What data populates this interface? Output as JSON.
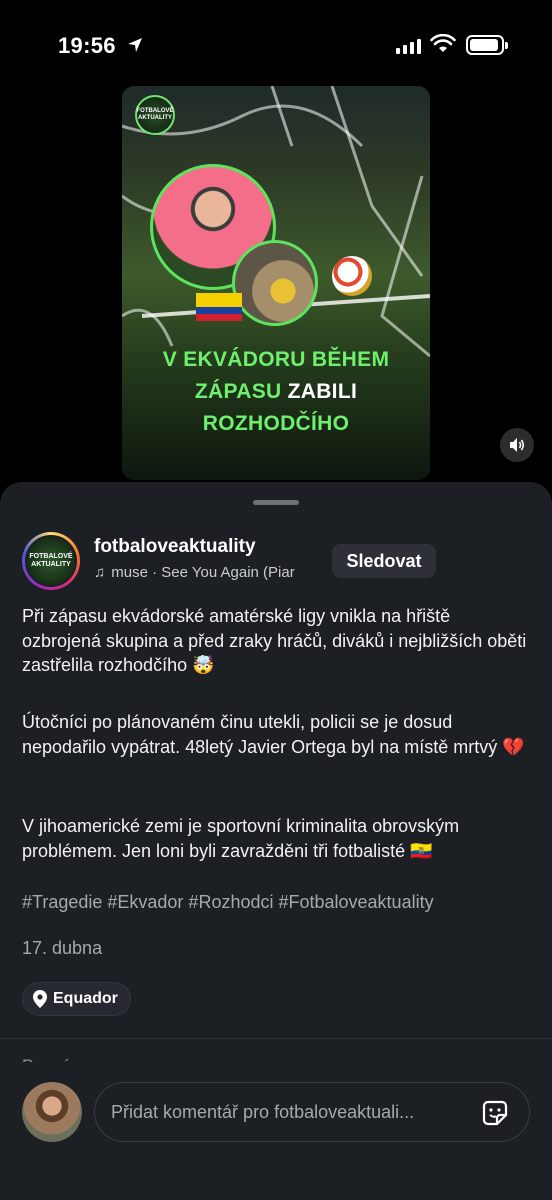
{
  "status_bar": {
    "time": "19:56"
  },
  "post_image": {
    "logo_text": "FOTBALOVÉ AKTUALITY",
    "headline_line1": "V EKVÁDORU BĚHEM",
    "headline_line2_a": "ZÁPASU",
    "headline_line2_b": "ZABILI",
    "headline_line3": "ROZHODČÍHO",
    "flag_colors": [
      "#f5d000",
      "#1d3f9e",
      "#d3202f"
    ]
  },
  "author": {
    "avatar_text": "FOTBALOVÉ AKTUALITY",
    "username": "fotbaloveaktuality",
    "music": "muse · See You Again (Piar",
    "follow_label": "Sledovat"
  },
  "caption": {
    "p1": "Při zápasu ekvádorské amatérské ligy vnikla na hřiště ozbrojená skupina a před zraky hráčů, diváků i nejbližších oběti zastřelila rozhodčího 🤯",
    "p2": "Útočníci po plánovaném činu utekli, policii se je dosud nepodařilo vypátrat. 48letý Javier Ortega byl na místě mrtvý 💔",
    "p3": "V jihoamerické zemi je sportovní kriminalita obrovským problémem. Jen loni byli zavražděni tři fotbalisté 🇪🇨",
    "hashtags": "#Tragedie #Ekvador #Rozhodci #Fotbaloveaktuality"
  },
  "date": "17. dubna",
  "location": "Equador",
  "for_you": "Pro vás",
  "comment": {
    "placeholder": "Přidat komentář pro fotbaloveaktuali..."
  },
  "colors": {
    "accent_green": "#6ef06e",
    "sheet_bg": "#1c1f24"
  }
}
